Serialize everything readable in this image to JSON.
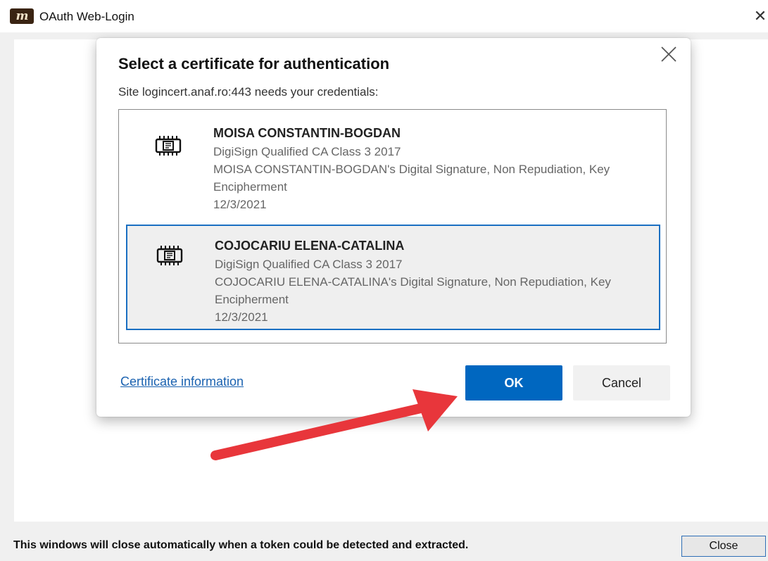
{
  "window": {
    "title": "OAuth Web-Login",
    "logo_text": "m",
    "close_glyph": "✕"
  },
  "dialog": {
    "title": "Select a certificate for authentication",
    "subtitle": "Site logincert.anaf.ro:443 needs your credentials:",
    "close_icon": "close-icon",
    "certificates": [
      {
        "name": "MOISA CONSTANTIN-BOGDAN",
        "issuer": "DigiSign Qualified CA Class 3 2017",
        "description": "MOISA CONSTANTIN-BOGDAN's Digital Signature, Non Repudiation, Key Encipherment",
        "date": "12/3/2021",
        "selected": false,
        "icon": "certificate-chip-icon"
      },
      {
        "name": "COJOCARIU ELENA-CATALINA",
        "issuer": "DigiSign Qualified CA Class 3 2017",
        "description": "COJOCARIU ELENA-CATALINA's Digital Signature, Non Repudiation, Key Encipherment",
        "date": "12/3/2021",
        "selected": true,
        "icon": "certificate-chip-icon"
      }
    ],
    "certificate_info_link": "Certificate information",
    "ok_label": "OK",
    "cancel_label": "Cancel"
  },
  "status_bar": {
    "message": "This windows will close automatically when a token could be detected and extracted.",
    "close_label": "Close"
  },
  "colors": {
    "accent": "#0067c0",
    "selection_border": "#1a6fc2",
    "annotation_arrow": "#e8363b"
  }
}
